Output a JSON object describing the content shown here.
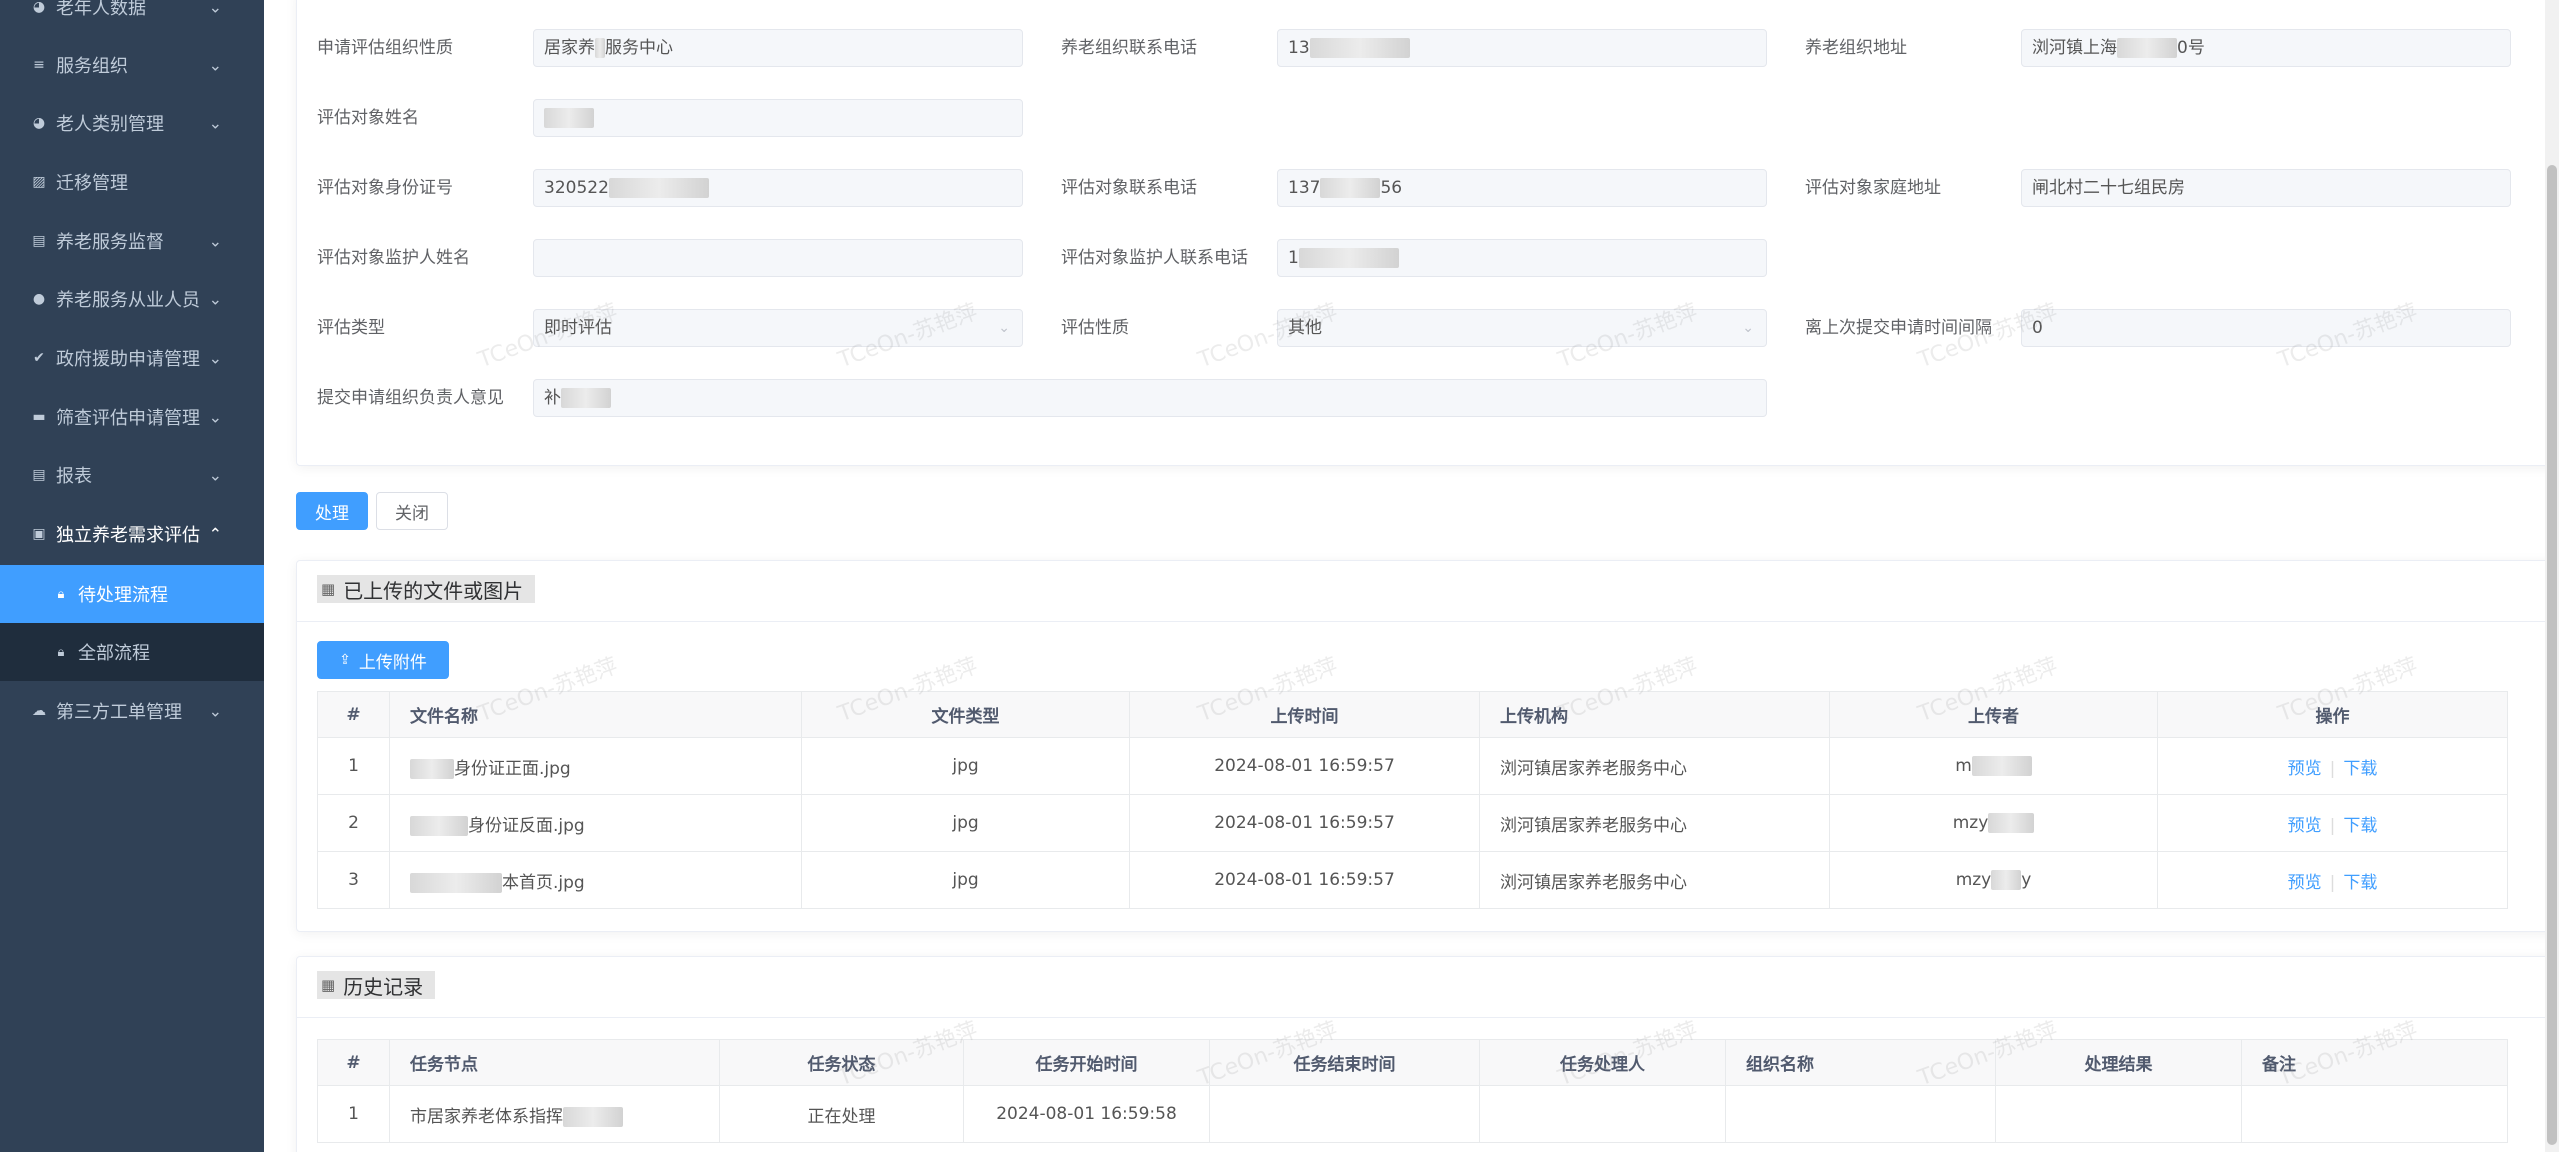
{
  "sidebar": {
    "items": [
      {
        "label": "老年人数据",
        "icon": "user-icon",
        "arrow": "⌄"
      },
      {
        "label": "服务组织",
        "icon": "list-icon",
        "arrow": "⌄"
      },
      {
        "label": "老人类别管理",
        "icon": "user-icon",
        "arrow": "⌄"
      },
      {
        "label": "迁移管理",
        "icon": "chart-icon",
        "arrow": ""
      },
      {
        "label": "养老服务监督",
        "icon": "clipboard-icon",
        "arrow": "⌄"
      },
      {
        "label": "养老服务从业人员",
        "icon": "group-icon",
        "arrow": "⌄"
      },
      {
        "label": "政府援助申请管理",
        "icon": "check-circle-icon",
        "arrow": "⌄"
      },
      {
        "label": "筛查评估申请管理",
        "icon": "card-icon",
        "arrow": "⌄"
      },
      {
        "label": "报表",
        "icon": "clipboard-icon",
        "arrow": "⌄"
      },
      {
        "label": "独立养老需求评估",
        "icon": "document-icon",
        "arrow": "⌃"
      }
    ],
    "subitems": [
      {
        "label": "待处理流程",
        "icon": "lock-icon"
      },
      {
        "label": "全部流程",
        "icon": "lock-icon"
      }
    ],
    "last_item": {
      "label": "第三方工单管理",
      "icon": "cloud-icon",
      "arrow": "⌄"
    }
  },
  "form": {
    "org_nature_label": "申请评估组织性质",
    "org_nature_value_a": "居家养",
    "org_nature_value_b": "服务中心",
    "org_phone_label": "养老组织联系电话",
    "org_phone_value": "13",
    "org_address_label": "养老组织地址",
    "org_address_value_a": "浏河镇上海",
    "org_address_value_b": "0号",
    "target_name_label": "评估对象姓名",
    "target_name_value": "",
    "target_id_label": "评估对象身份证号",
    "target_id_value": "320522",
    "target_phone_label": "评估对象联系电话",
    "target_phone_value_a": "137",
    "target_phone_value_b": "56",
    "target_address_label": "评估对象家庭地址",
    "target_address_value": "闸北村二十七组民房",
    "guardian_name_label": "评估对象监护人姓名",
    "guardian_name_value": "",
    "guardian_phone_label": "评估对象监护人联系电话",
    "guardian_phone_value": "1",
    "eval_type_label": "评估类型",
    "eval_type_value": "即时评估",
    "eval_nature_label": "评估性质",
    "eval_nature_value": "其他",
    "interval_label": "离上次提交申请时间间隔",
    "interval_value": "0",
    "opinion_label": "提交申请组织负责人意见",
    "opinion_value": "补"
  },
  "actions": {
    "process_label": "处理",
    "close_label": "关闭"
  },
  "files": {
    "title": "已上传的文件或图片",
    "upload_label": "上传附件",
    "columns": [
      "#",
      "文件名称",
      "文件类型",
      "上传时间",
      "上传机构",
      "上传者",
      "操作"
    ],
    "rows": [
      {
        "index": "1",
        "name": "身份证正面.jpg",
        "type": "jpg",
        "time": "2024-08-01 16:59:57",
        "org": "浏河镇居家养老服务中心",
        "uploader": "m",
        "preview": "预览",
        "download": "下载"
      },
      {
        "index": "2",
        "name": "身份证反面.jpg",
        "type": "jpg",
        "time": "2024-08-01 16:59:57",
        "org": "浏河镇居家养老服务中心",
        "uploader": "mzy",
        "preview": "预览",
        "download": "下载"
      },
      {
        "index": "3",
        "name": "本首页.jpg",
        "type": "jpg",
        "time": "2024-08-01 16:59:57",
        "org": "浏河镇居家养老服务中心",
        "uploader": "mzy",
        "uploader_tail": "y",
        "preview": "预览",
        "download": "下载"
      }
    ]
  },
  "history": {
    "title": "历史记录",
    "columns": [
      "#",
      "任务节点",
      "任务状态",
      "任务开始时间",
      "任务结束时间",
      "任务处理人",
      "组织名称",
      "处理结果",
      "备注"
    ],
    "rows": [
      {
        "index": "1",
        "node": "市居家养老体系指挥",
        "status": "正在处理",
        "start": "2024-08-01 16:59:58",
        "end": "",
        "handler": "",
        "org": "",
        "result": "",
        "remark": ""
      }
    ]
  },
  "watermark": "TCeOn-苏艳萍",
  "colors": {
    "sidebar_bg": "#304156",
    "active": "#409eff",
    "link": "#409eff"
  }
}
